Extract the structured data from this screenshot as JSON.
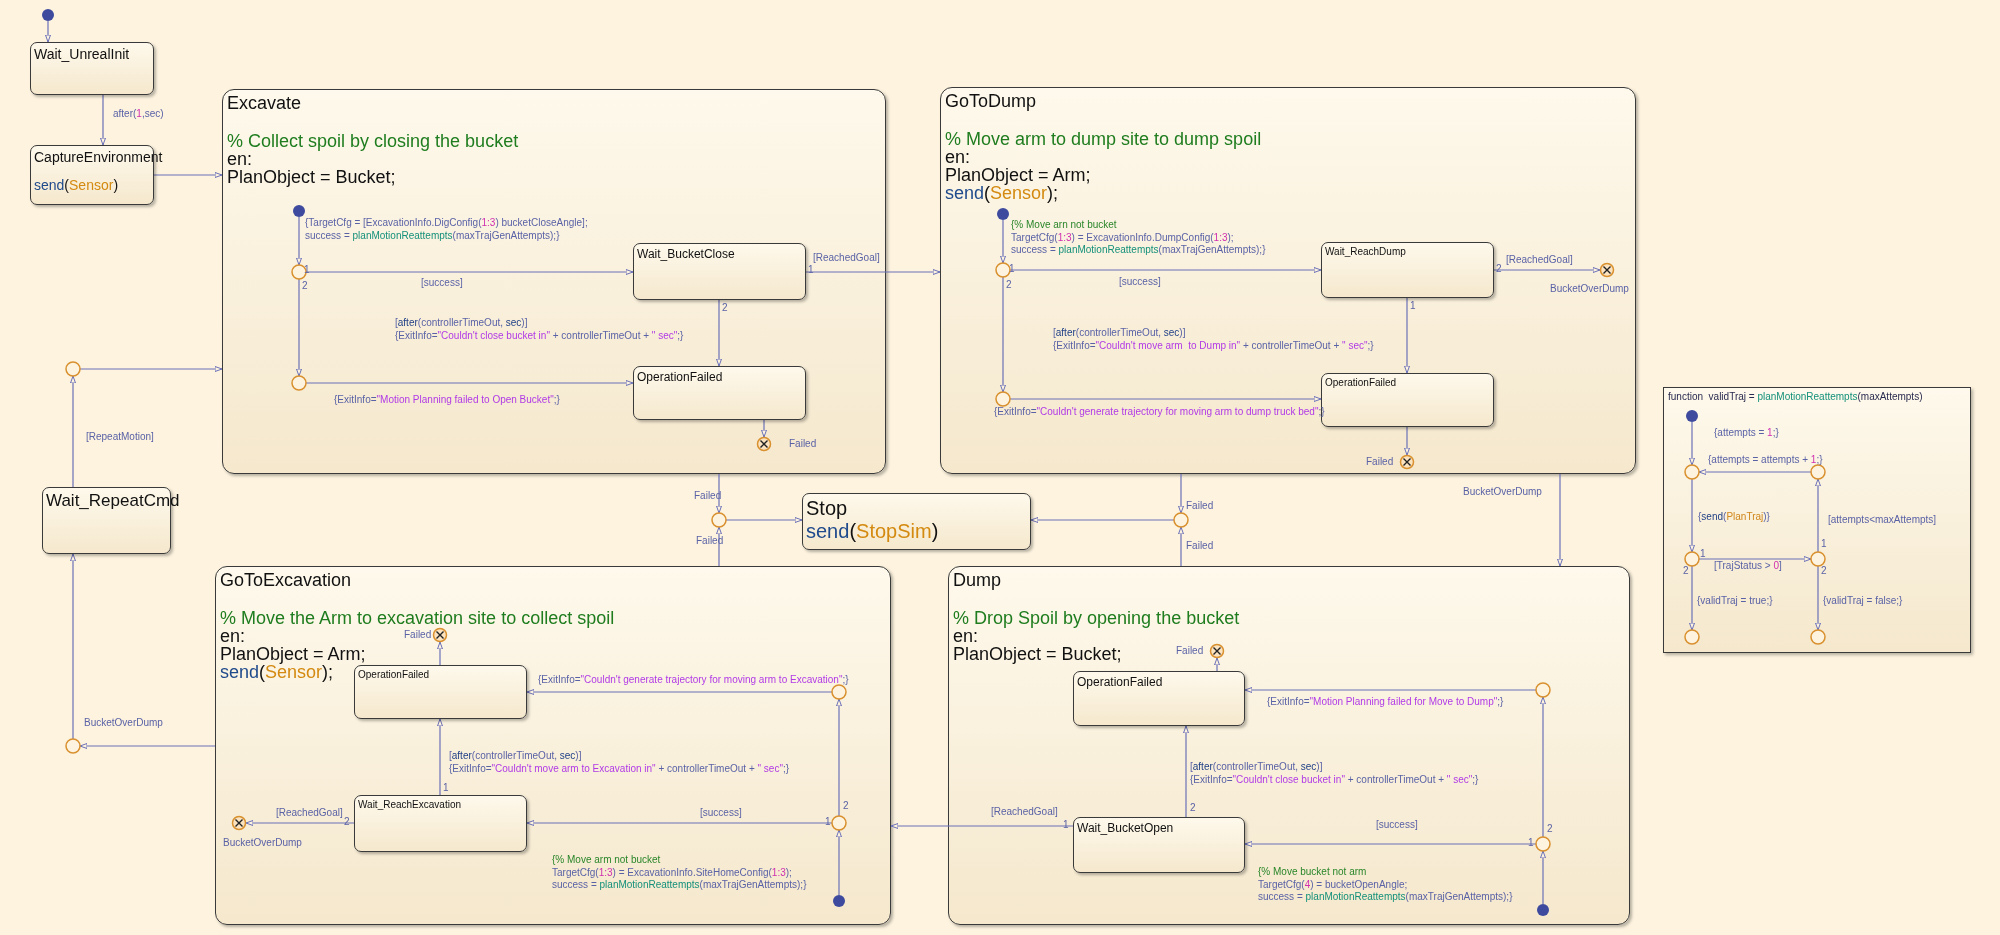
{
  "states": [
    {
      "name": "Wait_UnrealInit",
      "kind": "state"
    },
    {
      "name": "CaptureEnvironment",
      "kind": "state",
      "body": [
        [
          {
            "kind": "keyword",
            "text": "send"
          },
          {
            "kind": "plain",
            "text": "("
          },
          {
            "kind": "event",
            "text": "Sensor"
          },
          {
            "kind": "plain",
            "text": ")"
          }
        ]
      ]
    },
    {
      "name": "Excavate",
      "kind": "super",
      "body": [
        [
          {
            "kind": "comment",
            "text": "% Collect spoil by closing the bucket"
          }
        ],
        [
          {
            "kind": "plain",
            "text": "en:"
          }
        ],
        [
          {
            "kind": "plain",
            "text": "PlanObject = Bucket;"
          }
        ]
      ]
    },
    {
      "name": "GoToDump",
      "kind": "super",
      "body": [
        [
          {
            "kind": "comment",
            "text": "% Move arm to dump site to dump spoil"
          }
        ],
        [
          {
            "kind": "plain",
            "text": "en:"
          }
        ],
        [
          {
            "kind": "plain",
            "text": "PlanObject = Arm;"
          }
        ],
        [
          {
            "kind": "keyword",
            "text": "send"
          },
          {
            "kind": "plain",
            "text": "("
          },
          {
            "kind": "event",
            "text": "Sensor"
          },
          {
            "kind": "plain",
            "text": ");"
          }
        ]
      ]
    },
    {
      "name": "Wait_BucketClose",
      "kind": "inner"
    },
    {
      "name": "OperationFailed",
      "kind": "inner"
    },
    {
      "name": "Wait_ReachDump",
      "kind": "inner"
    },
    {
      "name": "OperationFailed",
      "kind": "inner"
    },
    {
      "name": "Wait_RepeatCmd",
      "kind": "state"
    },
    {
      "name": "Stop",
      "kind": "state",
      "body": [
        [
          {
            "kind": "keyword",
            "text": "send"
          },
          {
            "kind": "plain",
            "text": "("
          },
          {
            "kind": "event",
            "text": "StopSim"
          },
          {
            "kind": "plain",
            "text": ")"
          }
        ]
      ]
    },
    {
      "name": "GoToExcavation",
      "kind": "super",
      "body": [
        [
          {
            "kind": "comment",
            "text": "% Move the Arm to excavation site to collect spoil"
          }
        ],
        [
          {
            "kind": "plain",
            "text": "en:"
          }
        ],
        [
          {
            "kind": "plain",
            "text": "PlanObject = Arm;"
          }
        ],
        [
          {
            "kind": "keyword",
            "text": "send"
          },
          {
            "kind": "plain",
            "text": "("
          },
          {
            "kind": "event",
            "text": "Sensor"
          },
          {
            "kind": "plain",
            "text": ");"
          }
        ]
      ]
    },
    {
      "name": "Dump",
      "kind": "super",
      "body": [
        [
          {
            "kind": "comment",
            "text": "% Drop Spoil by opening the bucket"
          }
        ],
        [
          {
            "kind": "plain",
            "text": "en:"
          }
        ],
        [
          {
            "kind": "plain",
            "text": "PlanObject = Bucket;"
          }
        ]
      ]
    },
    {
      "name": "OperationFailed",
      "kind": "inner"
    },
    {
      "name": "Wait_ReachExcavation",
      "kind": "inner"
    },
    {
      "name": "OperationFailed",
      "kind": "inner"
    },
    {
      "name": "Wait_BucketOpen",
      "kind": "inner"
    }
  ],
  "labels": [
    {
      "lines": [
        [
          {
            "kind": "plain",
            "text": "after("
          },
          {
            "kind": "number",
            "text": "1"
          },
          {
            "kind": "plain",
            "text": ",sec)"
          }
        ]
      ]
    },
    {
      "text": "[RepeatMotion]"
    },
    {
      "text": "BucketOverDump"
    },
    {
      "lines": [
        [
          {
            "kind": "plain",
            "text": "{TargetCfg = [ExcavationInfo.DigConfig("
          },
          {
            "kind": "number",
            "text": "1:3"
          },
          {
            "kind": "plain",
            "text": ") bucketCloseAngle];"
          }
        ],
        [
          {
            "kind": "plain",
            "text": "success = "
          },
          {
            "kind": "function",
            "text": "planMotionReattempts"
          },
          {
            "kind": "plain",
            "text": "(maxTrajGenAttempts);}"
          }
        ]
      ]
    },
    {
      "text": "1"
    },
    {
      "text": "2"
    },
    {
      "text": "[success]"
    },
    {
      "text": "[ReachedGoal]"
    },
    {
      "text": "1"
    },
    {
      "text": "2"
    },
    {
      "lines": [
        [
          {
            "kind": "plain",
            "text": "["
          },
          {
            "kind": "keyword",
            "text": "after"
          },
          {
            "kind": "plain",
            "text": "(controllerTimeOut, "
          },
          {
            "kind": "keyword",
            "text": "sec"
          },
          {
            "kind": "plain",
            "text": ")]"
          }
        ],
        [
          {
            "kind": "plain",
            "text": "{ExitInfo="
          },
          {
            "kind": "string",
            "text": "\"Couldn't close bucket in\""
          },
          {
            "kind": "plain",
            "text": " + controllerTimeOut + "
          },
          {
            "kind": "string",
            "text": "\" sec\""
          },
          {
            "kind": "plain",
            "text": ";}"
          }
        ]
      ]
    },
    {
      "lines": [
        [
          {
            "kind": "plain",
            "text": "{ExitInfo="
          },
          {
            "kind": "string",
            "text": "\"Motion Planning failed to Open Bucket\""
          },
          {
            "kind": "plain",
            "text": ";}"
          }
        ]
      ]
    },
    {
      "text": "Failed"
    },
    {
      "lines": [
        [
          {
            "kind": "comment",
            "text": "{% Move arn not bucket"
          }
        ],
        [
          {
            "kind": "plain",
            "text": "TargetCfg("
          },
          {
            "kind": "number",
            "text": "1:3"
          },
          {
            "kind": "plain",
            "text": ") = ExcavationInfo.DumpConfig("
          },
          {
            "kind": "number",
            "text": "1:3"
          },
          {
            "kind": "plain",
            "text": ");"
          }
        ],
        [
          {
            "kind": "plain",
            "text": "success = "
          },
          {
            "kind": "function",
            "text": "planMotionReattempts"
          },
          {
            "kind": "plain",
            "text": "(maxTrajGenAttempts);}"
          }
        ]
      ]
    },
    {
      "text": "1"
    },
    {
      "text": "2"
    },
    {
      "text": "[success]"
    },
    {
      "text": "[ReachedGoal]"
    },
    {
      "text": "2"
    },
    {
      "text": "BucketOverDump"
    },
    {
      "text": "1"
    },
    {
      "lines": [
        [
          {
            "kind": "plain",
            "text": "["
          },
          {
            "kind": "keyword",
            "text": "after"
          },
          {
            "kind": "plain",
            "text": "(controllerTimeOut, "
          },
          {
            "kind": "keyword",
            "text": "sec"
          },
          {
            "kind": "plain",
            "text": ")]"
          }
        ],
        [
          {
            "kind": "plain",
            "text": "{ExitInfo="
          },
          {
            "kind": "string",
            "text": "\"Couldn't move arm  to Dump in\""
          },
          {
            "kind": "plain",
            "text": " + controllerTimeOut + "
          },
          {
            "kind": "string",
            "text": "\" sec\""
          },
          {
            "kind": "plain",
            "text": ";}"
          }
        ]
      ]
    },
    {
      "lines": [
        [
          {
            "kind": "plain",
            "text": "{ExitInfo="
          },
          {
            "kind": "string",
            "text": "\"Couldn't generate trajectory for moving arm to dump truck bed\""
          },
          {
            "kind": "plain",
            "text": ";}"
          }
        ]
      ]
    },
    {
      "text": "Failed"
    },
    {
      "text": "Failed"
    },
    {
      "text": "Failed"
    },
    {
      "text": "Failed"
    },
    {
      "text": "Failed"
    },
    {
      "text": "BucketOverDump"
    },
    {
      "text": "Failed"
    },
    {
      "lines": [
        [
          {
            "kind": "plain",
            "text": "{ExitInfo="
          },
          {
            "kind": "string",
            "text": "\"Couldn't generate trajectory for moving arm to Excavation\""
          },
          {
            "kind": "plain",
            "text": ";}"
          }
        ]
      ]
    },
    {
      "lines": [
        [
          {
            "kind": "plain",
            "text": "["
          },
          {
            "kind": "keyword",
            "text": "after"
          },
          {
            "kind": "plain",
            "text": "(controllerTimeOut, "
          },
          {
            "kind": "keyword",
            "text": "sec"
          },
          {
            "kind": "plain",
            "text": ")]"
          }
        ],
        [
          {
            "kind": "plain",
            "text": "{ExitInfo="
          },
          {
            "kind": "string",
            "text": "\"Couldn't move arm to Excavation in\""
          },
          {
            "kind": "plain",
            "text": " + controllerTimeOut + "
          },
          {
            "kind": "string",
            "text": "\" sec\""
          },
          {
            "kind": "plain",
            "text": ";}"
          }
        ]
      ]
    },
    {
      "text": "1"
    },
    {
      "text": "2"
    },
    {
      "text": "[success]"
    },
    {
      "text": "1"
    },
    {
      "text": "[ReachedGoal]"
    },
    {
      "text": "2"
    },
    {
      "text": "BucketOverDump"
    },
    {
      "lines": [
        [
          {
            "kind": "comment",
            "text": "{% Move arm not bucket"
          }
        ],
        [
          {
            "kind": "plain",
            "text": "TargetCfg("
          },
          {
            "kind": "number",
            "text": "1:3"
          },
          {
            "kind": "plain",
            "text": ") = ExcavationInfo.SiteHomeConfig("
          },
          {
            "kind": "number",
            "text": "1:3"
          },
          {
            "kind": "plain",
            "text": ");"
          }
        ],
        [
          {
            "kind": "plain",
            "text": "success = "
          },
          {
            "kind": "function",
            "text": "planMotionReattempts"
          },
          {
            "kind": "plain",
            "text": "(maxTrajGenAttempts);}"
          }
        ]
      ]
    },
    {
      "text": "Failed"
    },
    {
      "lines": [
        [
          {
            "kind": "plain",
            "text": "{ExitInfo="
          },
          {
            "kind": "string",
            "text": "\"Motion Planning failed for Move to Dump\""
          },
          {
            "kind": "plain",
            "text": ";}"
          }
        ]
      ]
    },
    {
      "lines": [
        [
          {
            "kind": "plain",
            "text": "["
          },
          {
            "kind": "keyword",
            "text": "after"
          },
          {
            "kind": "plain",
            "text": "(controllerTimeOut, "
          },
          {
            "kind": "keyword",
            "text": "sec"
          },
          {
            "kind": "plain",
            "text": ")]"
          }
        ],
        [
          {
            "kind": "plain",
            "text": "{ExitInfo="
          },
          {
            "kind": "string",
            "text": "\"Couldn't close bucket in\""
          },
          {
            "kind": "plain",
            "text": " + controllerTimeOut + "
          },
          {
            "kind": "string",
            "text": "\" sec\""
          },
          {
            "kind": "plain",
            "text": ";}"
          }
        ]
      ]
    },
    {
      "text": "2"
    },
    {
      "text": "[ReachedGoal]"
    },
    {
      "text": "1"
    },
    {
      "text": "[success]"
    },
    {
      "text": "2"
    },
    {
      "text": "1"
    },
    {
      "lines": [
        [
          {
            "kind": "comment",
            "text": "{% Move bucket not arm"
          }
        ],
        [
          {
            "kind": "plain",
            "text": "TargetCfg("
          },
          {
            "kind": "number",
            "text": "4"
          },
          {
            "kind": "plain",
            "text": ") = bucketOpenAngle;"
          }
        ],
        [
          {
            "kind": "plain",
            "text": "success = "
          },
          {
            "kind": "function",
            "text": "planMotionReattempts"
          },
          {
            "kind": "plain",
            "text": "(maxTrajGenAttempts);}"
          }
        ]
      ]
    },
    {
      "lines": [
        [
          {
            "kind": "plain",
            "text": "{attempts = "
          },
          {
            "kind": "number",
            "text": "1"
          },
          {
            "kind": "plain",
            "text": ";}"
          }
        ]
      ]
    },
    {
      "lines": [
        [
          {
            "kind": "plain",
            "text": "{attempts = attempts + "
          },
          {
            "kind": "number",
            "text": "1"
          },
          {
            "kind": "plain",
            "text": ";}"
          }
        ]
      ]
    },
    {
      "lines": [
        [
          {
            "kind": "plain",
            "text": "{"
          },
          {
            "kind": "keyword",
            "text": "send"
          },
          {
            "kind": "plain",
            "text": "("
          },
          {
            "kind": "event",
            "text": "PlanTraj"
          },
          {
            "kind": "plain",
            "text": ")}"
          }
        ]
      ]
    },
    {
      "text": "[attempts<maxAttempts]"
    },
    {
      "text": "1"
    },
    {
      "text": "1"
    },
    {
      "text": "2"
    },
    {
      "lines": [
        [
          {
            "kind": "plain",
            "text": "[TrajStatus > "
          },
          {
            "kind": "number",
            "text": "0"
          },
          {
            "kind": "plain",
            "text": "]"
          }
        ]
      ]
    },
    {
      "text": "2"
    },
    {
      "text": "{validTraj = true;}"
    },
    {
      "text": "{validTraj = false;}"
    }
  ],
  "function_box": {
    "header": [
      {
        "kind": "plain",
        "text": "function  validTraj = "
      },
      {
        "kind": "function",
        "text": "planMotionReattempts"
      },
      {
        "kind": "plain",
        "text": "(maxAttempts)"
      }
    ]
  }
}
